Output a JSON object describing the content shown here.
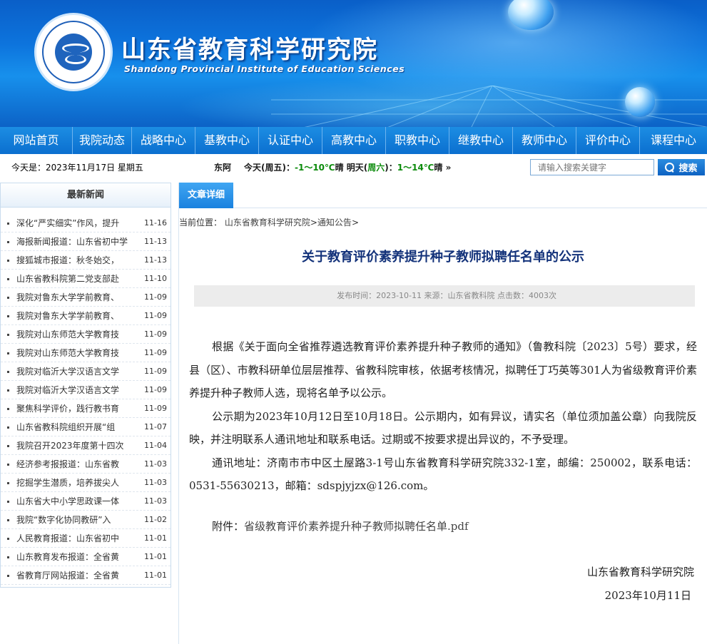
{
  "site": {
    "title": "山东省教育科学研究院",
    "subtitle": "Shandong Provincial Institute of Education Sciences"
  },
  "nav": {
    "items": [
      "网站首页",
      "我院动态",
      "战略中心",
      "基教中心",
      "认证中心",
      "高教中心",
      "职教中心",
      "继教中心",
      "教师中心",
      "评价中心",
      "课程中心"
    ]
  },
  "infobar": {
    "today": "今天是：2023年11月17日 星期五",
    "weather": {
      "city": "东阿",
      "today_label": "今天(周五)：",
      "today_temp": "-1～10℃",
      "today_cond": "晴",
      "tomorrow_label": "明天(",
      "tomorrow_day": "周六",
      "tomorrow_close": ")：",
      "tomorrow_temp": "1～14℃",
      "tomorrow_cond": "晴",
      "more": "»"
    }
  },
  "search": {
    "placeholder": "请输入搜索关键字",
    "button_label": "搜索"
  },
  "sidebar": {
    "header": "最新新闻",
    "items": [
      {
        "title": "深化“严实细实”作风，提升",
        "date": "11-16"
      },
      {
        "title": "海报新闻报道：山东省初中学",
        "date": "11-13"
      },
      {
        "title": "搜狐城市报道：秋冬始交，",
        "date": "11-13"
      },
      {
        "title": "山东省教科院第二党支部赴",
        "date": "11-10"
      },
      {
        "title": "我院对鲁东大学学前教育、",
        "date": "11-09"
      },
      {
        "title": "我院对鲁东大学学前教育、",
        "date": "11-09"
      },
      {
        "title": "我院对山东师范大学教育技",
        "date": "11-09"
      },
      {
        "title": "我院对山东师范大学教育技",
        "date": "11-09"
      },
      {
        "title": "我院对临沂大学汉语言文学",
        "date": "11-09"
      },
      {
        "title": "我院对临沂大学汉语言文学",
        "date": "11-09"
      },
      {
        "title": "聚焦科学评价，践行教书育",
        "date": "11-09"
      },
      {
        "title": "山东省教科院组织开展“组",
        "date": "11-07"
      },
      {
        "title": "我院召开2023年度第十四次",
        "date": "11-04"
      },
      {
        "title": "经济参考报报道：山东省教",
        "date": "11-03"
      },
      {
        "title": "挖掘学生潜质，培养拔尖人",
        "date": "11-03"
      },
      {
        "title": "山东省大中小学思政课一体",
        "date": "11-03"
      },
      {
        "title": "我院“数字化协同教研”入",
        "date": "11-02"
      },
      {
        "title": "人民教育报道：山东省初中",
        "date": "11-01"
      },
      {
        "title": "山东教育发布报道：全省黄",
        "date": "11-01"
      },
      {
        "title": "省教育厅网站报道：全省黄",
        "date": "11-01"
      }
    ]
  },
  "article": {
    "tab": "文章详细",
    "breadcrumb": {
      "label": "当前位置：",
      "home": "山东省教育科学研究院",
      "sep1": ">",
      "section": "通知公告",
      "sep2": ">"
    },
    "title": "关于教育评价素养提升种子教师拟聘任名单的公示",
    "meta": "发布时间：2023-10-11 来源：山东省教科院 点击数：4003次",
    "paragraphs": [
      "根据《关于面向全省推荐遴选教育评价素养提升种子教师的通知》（鲁教科院〔2023〕5号）要求，经县（区）、市教科研单位层层推荐、省教科院审核，依据考核情况，拟聘任丁巧英等301人为省级教育评价素养提升种子教师人选，现将名单予以公示。",
      "公示期为2023年10月12日至10月18日。公示期内，如有异议，请实名（单位须加盖公章）向我院反映，并注明联系人通讯地址和联系电话。过期或不按要求提出异议的，不予受理。",
      "通讯地址：济南市市中区土屋路3-1号山东省教育科学研究院332-1室，邮编：250002，联系电话：0531-55630213，邮箱：sdspjyjzx@126.com。"
    ],
    "attachment_label": "附件：",
    "attachment_file": "省级教育评价素养提升种子教师拟聘任名单.pdf",
    "sign_org": "山东省教育科学研究院",
    "sign_date": "2023年10月11日"
  }
}
